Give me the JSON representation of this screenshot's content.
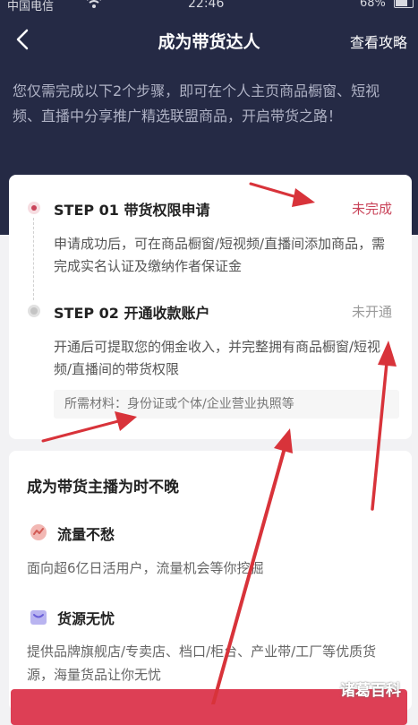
{
  "status_bar": {
    "carrier": "中国电信",
    "time": "22:46",
    "battery": "68%"
  },
  "nav": {
    "title": "成为带货达人",
    "right_link": "查看攻略"
  },
  "intro": "您仅需完成以下2个步骤，即可在个人主页商品橱窗、短视频、直播中分享推广精选联盟商品，开启带货之路！",
  "steps": [
    {
      "title": "STEP 01 带货权限申请",
      "status": "未完成",
      "description": "申请成功后，可在商品橱窗/短视频/直播间添加商品，需完成实名认证及缴纳作者保证金"
    },
    {
      "title": "STEP 02 开通收款账户",
      "status": "未开通",
      "description": "开通后可提取您的佣金收入，并完整拥有商品橱窗/短视频/直播间的带货权限",
      "materials": "所需材料：身份证或个体/企业营业执照等"
    }
  ],
  "promo": {
    "title": "成为带货主播为时不晚",
    "features": [
      {
        "icon": "traffic-icon",
        "title": "流量不愁",
        "description": "面向超6亿日活用户，流量机会等你挖掘"
      },
      {
        "icon": "goods-icon",
        "title": "货源无忧",
        "description": "提供品牌旗舰店/专卖店、档口/柜台、产业带/工厂等优质货源，海量货品让你无忧"
      }
    ]
  },
  "watermark": "诸葛百科",
  "colors": {
    "header_bg": "#252a45",
    "accent": "#c9445a",
    "button": "#dd3f55",
    "arrow": "#d8333a"
  }
}
